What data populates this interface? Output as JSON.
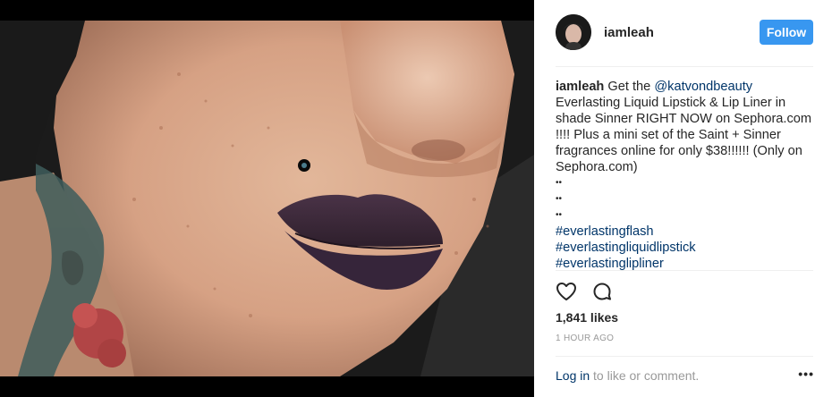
{
  "post": {
    "username": "iamleah",
    "follow_label": "Follow",
    "caption": {
      "username": "iamleah",
      "l1_pre": "Get the ",
      "mention": "@katvondbeauty",
      "l2": "Everlasting Liquid Lipstick & Lip Liner in",
      "l3": "shade Sinner RIGHT NOW on Sephora.com",
      "l4": "!!!! Plus a mini set of the Saint + Sinner",
      "l5": "fragrances online for only $38!!!!!! (Only on",
      "l6": "Sephora.com)",
      "dots": [
        "••",
        "••",
        "••"
      ],
      "hashtags": [
        "#everlastingflash",
        "#everlastingliquidlipstick",
        "#everlastinglipliner"
      ]
    },
    "likes": "1,841 likes",
    "time": "1 HOUR AGO",
    "login": {
      "link": "Log in",
      "rest": " to like or comment."
    },
    "more_label": "•••"
  },
  "icons": {
    "like": "heart-icon",
    "comment": "comment-icon",
    "more": "more-options-icon"
  },
  "colors": {
    "follow_button": "#3897f0",
    "link": "#003569",
    "muted": "#999999",
    "lipstick": "#3f2a3c"
  }
}
